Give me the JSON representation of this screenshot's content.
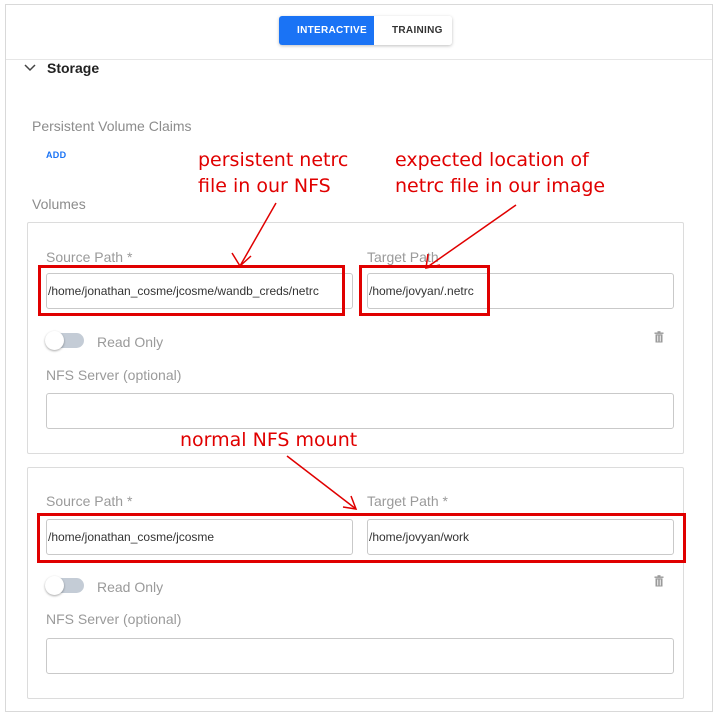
{
  "mode_toggle": {
    "interactive": "INTERACTIVE",
    "training": "TRAINING"
  },
  "storage": {
    "title": "Storage",
    "pvc_label": "Persistent Volume Claims",
    "add_label": "ADD",
    "volumes_label": "Volumes",
    "volumes": [
      {
        "source_label": "Source Path *",
        "source_value": "/home/jonathan_cosme/jcosme/wandb_creds/netrc",
        "target_label": "Target Path",
        "target_value": "/home/jovyan/.netrc",
        "read_only_label": "Read Only",
        "nfs_label": "NFS Server (optional)",
        "nfs_value": ""
      },
      {
        "source_label": "Source Path *",
        "source_value": "/home/jonathan_cosme/jcosme",
        "target_label": "Target Path *",
        "target_value": "/home/jovyan/work",
        "read_only_label": "Read Only",
        "nfs_label": "NFS Server (optional)",
        "nfs_value": ""
      }
    ]
  },
  "annotations": {
    "a1_line1": "persistent netrc",
    "a1_line2": "file in our NFS",
    "a2_line1": "expected location of",
    "a2_line2": "netrc file in our image",
    "a3": "normal NFS mount"
  },
  "colors": {
    "accent": "#1a73f5",
    "annotation": "#e00000"
  }
}
